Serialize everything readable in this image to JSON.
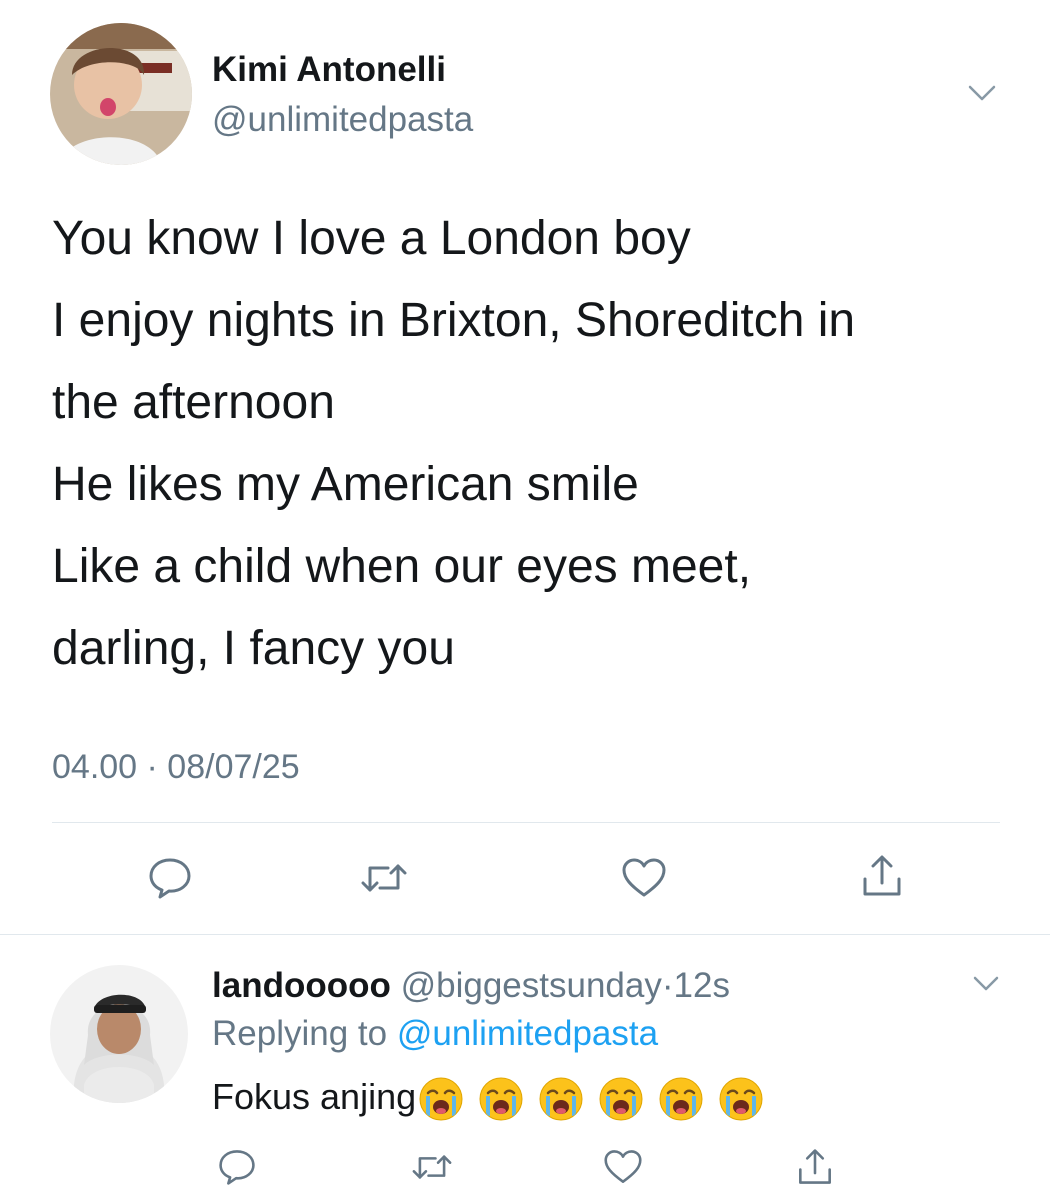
{
  "tweet": {
    "author_name": "Kimi Antonelli",
    "author_handle": "@unlimitedpasta",
    "avatar_icon": "user-photo-avatar",
    "lines": [
      "You know I love a London boy",
      "I enjoy nights in Brixton, Shoreditch in",
      "the afternoon",
      "He likes my American smile",
      "Like a child when our eyes meet,",
      "darling, I fancy you"
    ],
    "timestamp": "04.00 · 08/07/25",
    "actions": [
      "reply-icon",
      "retweet-icon",
      "like-icon",
      "share-icon"
    ]
  },
  "reply": {
    "author_name": "landooooo",
    "author_handle": "@biggestsunday",
    "separator": "·",
    "time": "12s",
    "replying_prefix": "Replying to",
    "replying_handle": "@unlimitedpasta",
    "text": "Fokus anjing",
    "emoji_count": 6,
    "emoji_name": "loudly-crying-face-emoji",
    "actions": [
      "reply-icon",
      "retweet-icon",
      "like-icon",
      "share-icon"
    ]
  },
  "colors": {
    "text": "#14171a",
    "secondary": "#657786",
    "link": "#1da1f2",
    "divider": "#e1e8ed",
    "emoji_face": "#fcc21b",
    "emoji_tears": "#5fb6e8"
  }
}
